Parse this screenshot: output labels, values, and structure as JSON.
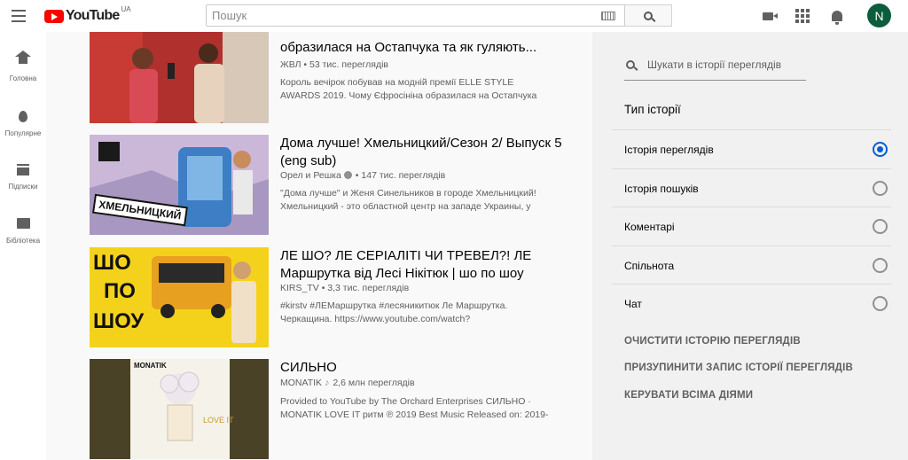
{
  "header": {
    "logo_text": "YouTube",
    "region": "UA",
    "search_placeholder": "Пошук",
    "avatar_letter": "N"
  },
  "guide": [
    {
      "label": "Головна",
      "icon": "home-icon"
    },
    {
      "label": "Популярне",
      "icon": "fire-icon"
    },
    {
      "label": "Підписки",
      "icon": "subscriptions-icon"
    },
    {
      "label": "Бібліотека",
      "icon": "library-icon"
    }
  ],
  "videos": [
    {
      "title": "образилася на Остапчука та як гуляють...",
      "channel": "ЖВЛ",
      "views": "53 тис. переглядів",
      "desc": "Король вечірок побував на модній премії ELLE STYLE AWARDS 2019. Чому Єфросініна образилася на Остапчука"
    },
    {
      "title": "Дома лучше! Хмельницкий/Сезон 2/ Выпуск 5 (eng sub)",
      "channel": "Орел и Решка",
      "views": "147 тис. переглядів",
      "desc": "\"Дома лучше\" и Женя Синельников в городе Хмельницкий! Хмельницкий - это областной центр на западе Украины, у",
      "thumb_text": "ХМЕЛЬНИЦКИЙ"
    },
    {
      "title": "ЛЕ ШО? ЛЕ СЕРІАЛІТІ ЧИ ТРЕВЕЛ?! ЛЕ Маршрутка від Лесі Нікітюк | шо по шоу",
      "channel": "KIRS_TV",
      "views": "3,3 тис. переглядів",
      "desc": "#kirstv #ЛЕМаршрутка #лесяникитюк Ле Маршрутка. Черкащина. https://www.youtube.com/watch?",
      "thumb_words": [
        "ШО",
        "ПО",
        "ШОУ"
      ]
    },
    {
      "title": "СИЛЬНО",
      "channel": "MONATIK",
      "views": "2,6 млн переглядів",
      "desc": "Provided to YouTube by The Orchard Enterprises СИЛЬНО · MONATIK LOVE IT ритм ℗ 2019 Best Music Released on: 2019-",
      "thumb_text": "MONATIK"
    }
  ],
  "panel": {
    "search_placeholder": "Шукати в історії переглядів",
    "heading": "Тип історії",
    "options": [
      {
        "label": "Історія переглядів",
        "checked": true
      },
      {
        "label": "Історія пошуків",
        "checked": false
      },
      {
        "label": "Коментарі",
        "checked": false
      },
      {
        "label": "Спільнота",
        "checked": false
      },
      {
        "label": "Чат",
        "checked": false
      }
    ],
    "actions": [
      "ОЧИСТИТИ ІСТОРІЮ ПЕРЕГЛЯДІВ",
      "ПРИЗУПИНИТИ ЗАПИС ІСТОРІЇ ПЕРЕГЛЯДІВ",
      "КЕРУВАТИ ВСІМА ДІЯМИ"
    ]
  },
  "colors": {
    "brand_red": "#ff0000",
    "radio_selected": "#065fd4",
    "avatar_bg": "#0b5d3b"
  }
}
